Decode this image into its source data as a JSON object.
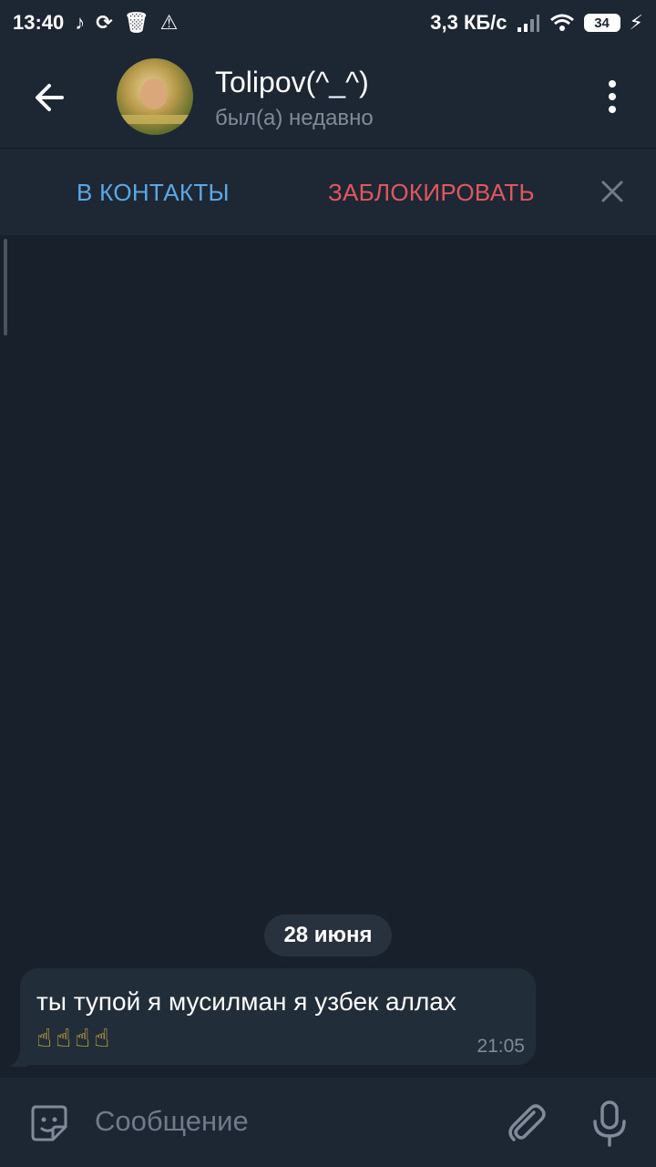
{
  "status_bar": {
    "time": "13:40",
    "speed": "3,3 КБ/с",
    "battery": "34",
    "icons": [
      "tiktok-icon",
      "sync-icon",
      "trash-icon",
      "warning-icon",
      "signal-icon",
      "wifi-icon",
      "battery-icon",
      "charging-icon"
    ]
  },
  "header": {
    "title": "Tolipov(^_^)",
    "subtitle": "был(а) недавно"
  },
  "action_bar": {
    "add_contact": "В КОНТАКТЫ",
    "block": "ЗАБЛОКИРОВАТЬ"
  },
  "chat": {
    "date": "28 июня",
    "messages": [
      {
        "text": "ты тупой я мусилман я узбек аллах",
        "emojis": [
          "☝",
          "☝",
          "☝",
          "☝"
        ],
        "time": "21:05"
      }
    ]
  },
  "composer": {
    "placeholder": "Сообщение"
  },
  "colors": {
    "background": "#18202b",
    "header": "#1d2633",
    "accent_blue": "#5ca8e6",
    "accent_red": "#e0585f",
    "bubble": "#222d3a"
  }
}
